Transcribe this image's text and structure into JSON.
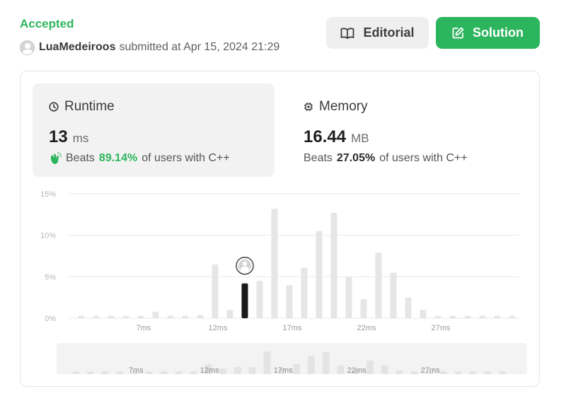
{
  "status": "Accepted",
  "submission": {
    "username": "LuaMedeiroos",
    "submitted_text": "submitted at Apr 15, 2024 21:29"
  },
  "buttons": {
    "editorial": "Editorial",
    "solution": "Solution"
  },
  "runtime": {
    "title": "Runtime",
    "value": "13",
    "unit": "ms",
    "beats_prefix": "Beats",
    "beats_pct": "89.14%",
    "beats_suffix": "of users with C++"
  },
  "memory": {
    "title": "Memory",
    "value": "16.44",
    "unit": "MB",
    "beats_prefix": "Beats",
    "beats_pct": "27.05%",
    "beats_suffix": "of users with C++"
  },
  "colors": {
    "accent_green": "#2db55d",
    "bar_gray": "#e6e6e6",
    "bar_highlight": "#1a1a1a"
  },
  "chart_data": {
    "type": "bar",
    "xlabel": "",
    "ylabel": "",
    "ylim": [
      0,
      15
    ],
    "y_ticks": [
      "0%",
      "5%",
      "10%",
      "15%"
    ],
    "x_ticks": [
      "7ms",
      "12ms",
      "17ms",
      "22ms",
      "27ms"
    ],
    "grid": true,
    "highlight_index": 11,
    "values": [
      0.3,
      0.3,
      0.3,
      0.3,
      0.3,
      0.8,
      0.3,
      0.3,
      0.4,
      6.5,
      1.0,
      4.2,
      4.5,
      13.2,
      4.0,
      6.1,
      10.5,
      12.7,
      5.0,
      2.3,
      7.9,
      5.5,
      2.5,
      1.0,
      0.3,
      0.3,
      0.3,
      0.3,
      0.3,
      0.3
    ],
    "overview_values": [
      0.2,
      0.2,
      0.2,
      0.2,
      0.2,
      0.4,
      0.2,
      0.2,
      0.3,
      1.4,
      0.8,
      1.0,
      1.0,
      3.2,
      0.8,
      1.4,
      2.6,
      3.1,
      1.2,
      0.6,
      1.9,
      1.3,
      0.5,
      0.3,
      0.2,
      0.2,
      0.2,
      0.2,
      0.2,
      0.2
    ]
  }
}
